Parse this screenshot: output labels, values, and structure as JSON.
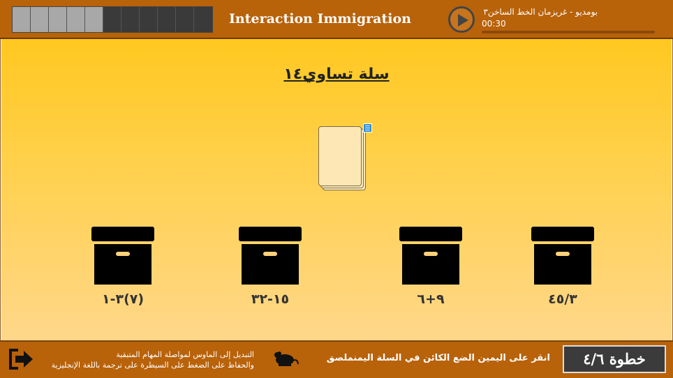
{
  "header": {
    "title": "Interaction Immigration",
    "progress": {
      "total": 11,
      "completed": 5
    },
    "audio": {
      "title": "بومديو - غريزمان الخط الساخن٣",
      "time": "00:30",
      "progress": 0.0
    }
  },
  "activity": {
    "question": "سلة تساوي١٤",
    "bins": [
      {
        "label": "(٧)٣-١"
      },
      {
        "label": "١٥-٣٢"
      },
      {
        "label": "٩+٦"
      },
      {
        "label": "٤٥/٣"
      }
    ]
  },
  "footer": {
    "hint_line1": "التبديل إلى الماوس لمواصلة المهام المتبقية",
    "hint_line2": "والحفاظ على الضغط على السيطرة على ترجمة باللغة الإنجليزية",
    "instruction": "انقر على اليمين الضع الكائن في السلة اليمنملصق",
    "step": "خطوة ٤/٦"
  },
  "colors": {
    "header_bg": "#b8620a",
    "main_gradient_top": "#ffc820",
    "main_gradient_bottom": "#ffd78a",
    "bin": "#000000",
    "step_bg": "#3b3b3b"
  }
}
